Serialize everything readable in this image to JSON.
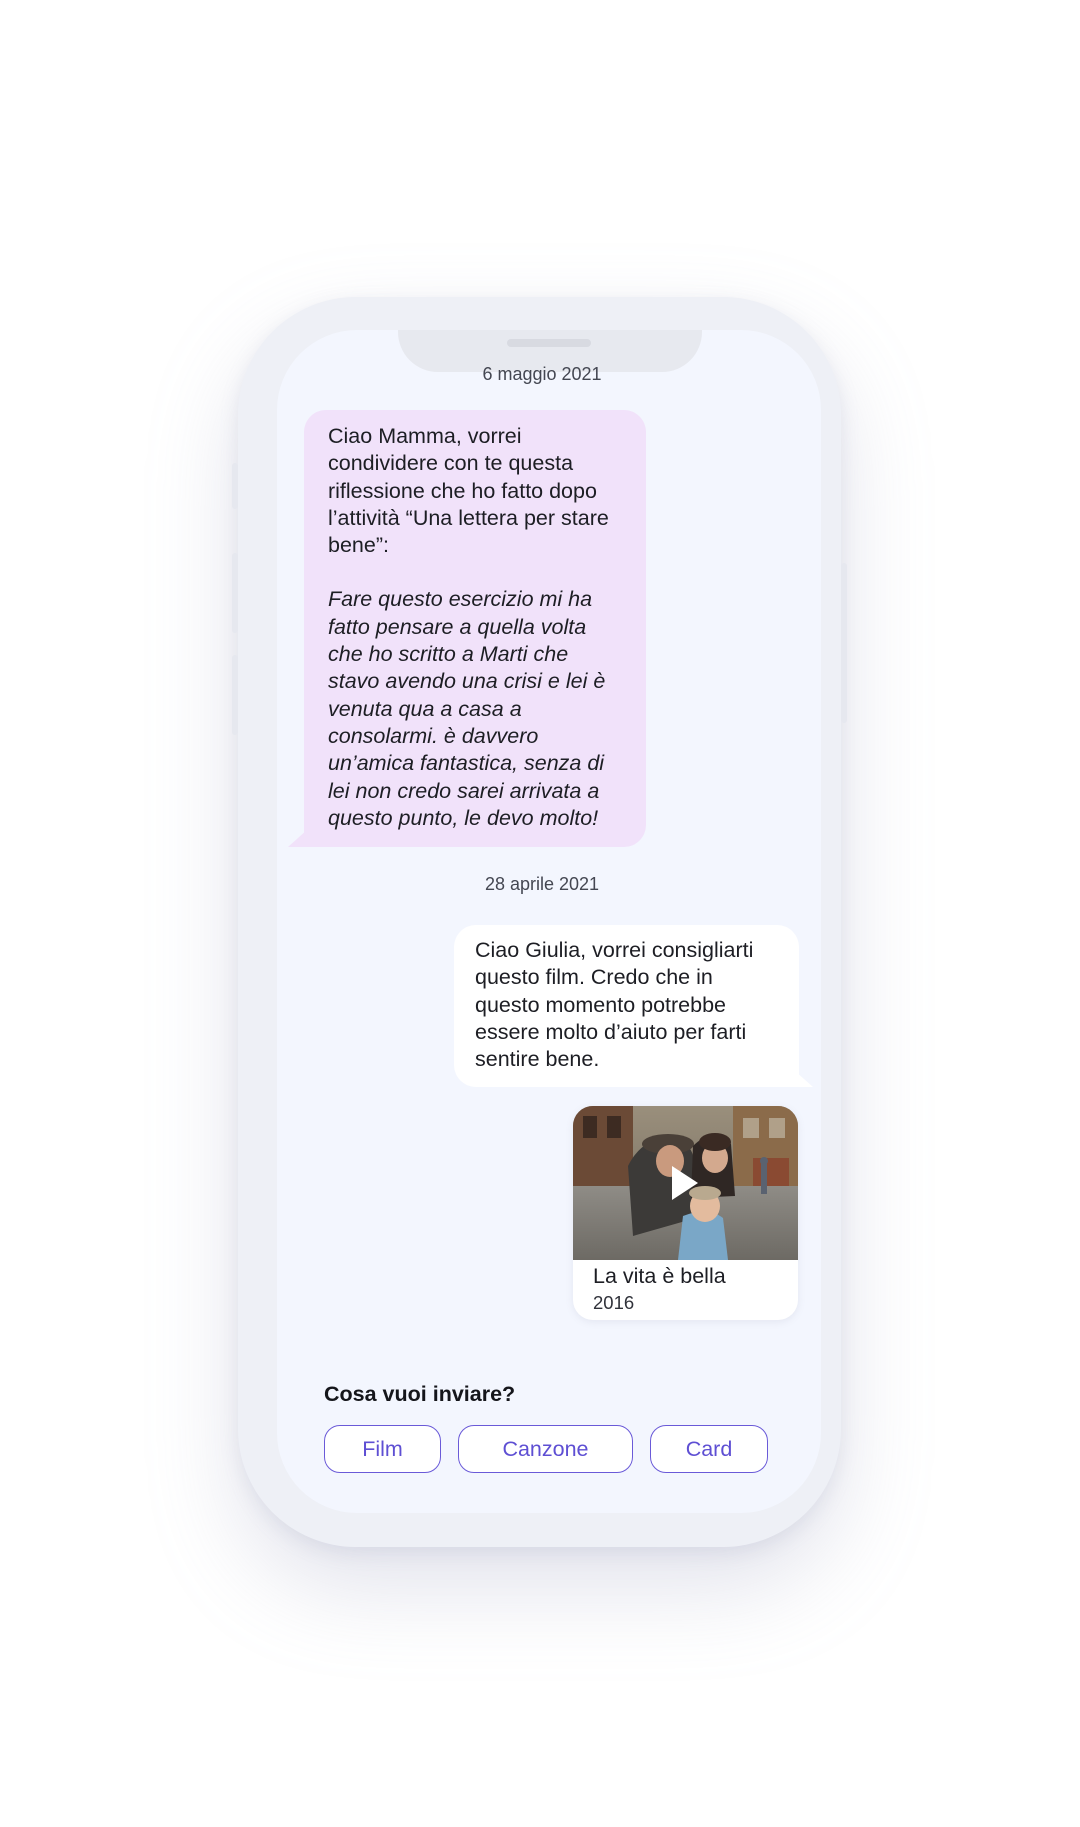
{
  "chat": {
    "messages": [
      {
        "date": "6 maggio 2021",
        "direction": "incoming",
        "lines": [
          "Ciao Mamma, vorrei",
          "condividere con te questa",
          "riflessione che ho fatto dopo",
          "l’attività “Una lettera per stare",
          "bene”:"
        ],
        "quote_lines": [
          "Fare questo esercizio mi ha",
          "fatto pensare a quella volta",
          "che ho scritto a Marti che",
          "stavo avendo una crisi e lei è",
          "venuta qua a casa a",
          "consolarmi. è davvero",
          "un’amica fantastica, senza di",
          "lei non credo sarei arrivata a",
          "questo punto, le devo molto!"
        ]
      },
      {
        "date": "28 aprile 2021",
        "direction": "outgoing",
        "lines": [
          "Ciao Giulia, vorrei consigliarti",
          "questo film. Credo che in",
          "questo momento potrebbe",
          "essere molto d’aiuto per farti",
          "sentire bene."
        ]
      }
    ],
    "film": {
      "title": "La vita è bella",
      "year": "2016",
      "icon": "play-icon"
    }
  },
  "composer": {
    "prompt": "Cosa vuoi inviare?",
    "options": [
      "Film",
      "Canzone",
      "Card"
    ]
  },
  "colors": {
    "screen_bg": "#f3f6fe",
    "incoming_bubble": "#f1e2fa",
    "outgoing_bubble": "#ffffff",
    "accent": "#6a5ad8"
  }
}
